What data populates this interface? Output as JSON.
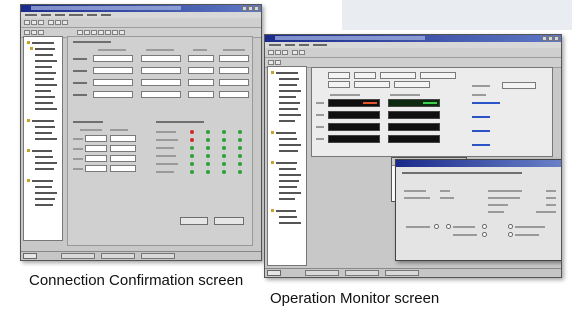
{
  "captions": {
    "connection_confirmation": "Connection Confirmation screen",
    "operation_monitor": "Operation Monitor screen"
  },
  "colors": {
    "title_bar": "#1a2a8a",
    "window_face": "#c8c8c8",
    "readout_red": "#e7552b",
    "readout_green": "#3ed24a",
    "status_red": "#d22b2b",
    "status_green": "#2fa236",
    "link_blue": "#2b54c8"
  }
}
